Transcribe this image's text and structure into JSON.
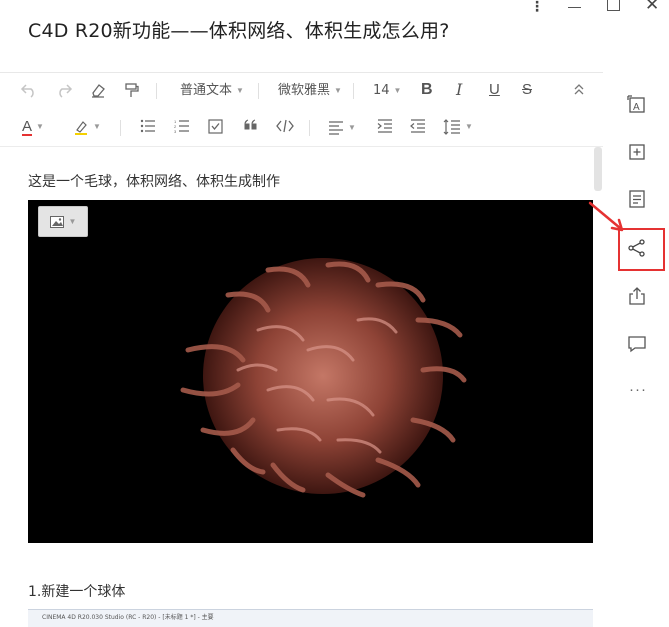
{
  "window": {
    "more_glyph": "⋮",
    "close_glyph": "✕"
  },
  "document": {
    "title": "C4D R20新功能——体积网络、体积生成怎么用?"
  },
  "toolbar": {
    "undo_icon": "undo-icon",
    "redo_icon": "redo-icon",
    "style_select": "普通文本",
    "font_select": "微软雅黑",
    "size_select": "14",
    "bold_label": "B",
    "italic_label": "I",
    "underline_label": "U",
    "strike_label": "S",
    "font_color_label": "A",
    "accent_color": "#e53232"
  },
  "content": {
    "paragraph_1": "这是一个毛球，体积网络、体积生成制作",
    "paragraph_2": "1.新建一个球体",
    "screenshot_caption": "CINEMA 4D R20.030 Studio (RC - R20) - [未标题 1 *] - 主要"
  },
  "right_rail": {
    "more_label": "···",
    "highlight_color": "#e53232"
  }
}
